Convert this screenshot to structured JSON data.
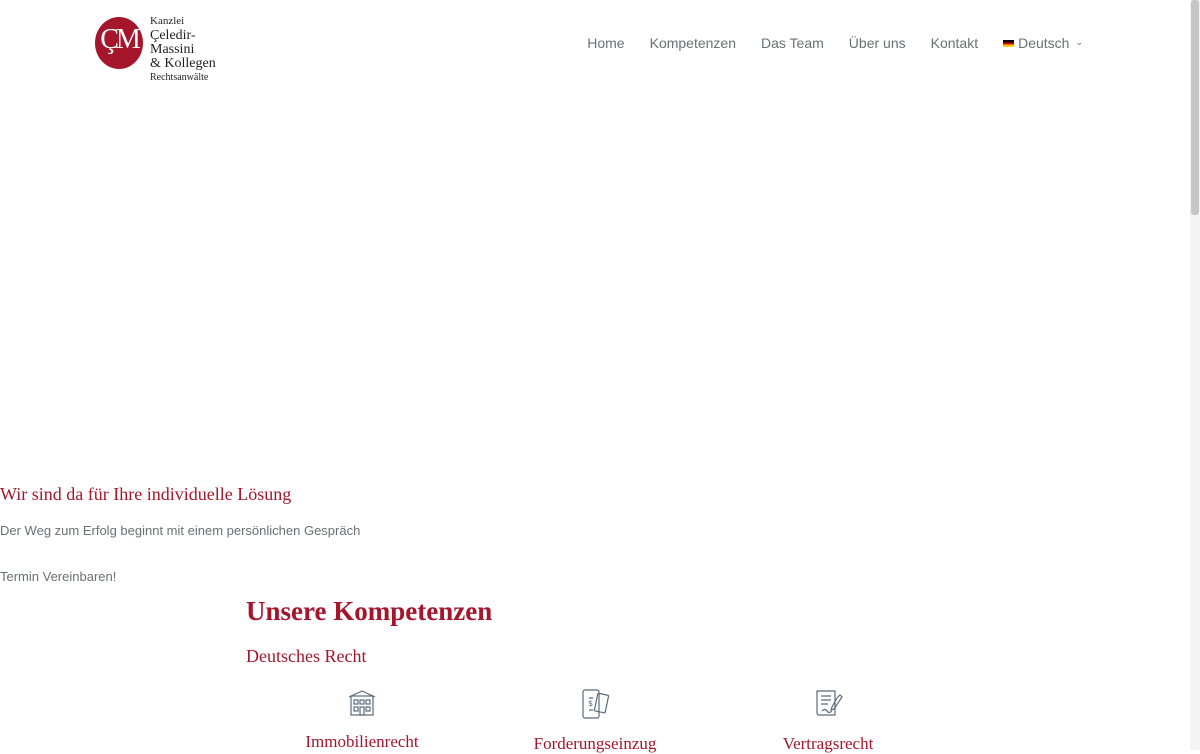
{
  "logo": {
    "mark": "ÇM",
    "line1": "Kanzlei",
    "line2": "Çeledir-Massini",
    "line3": "& Kollegen",
    "line4": "Rechtsanwälte"
  },
  "nav": {
    "items": [
      {
        "label": "Home"
      },
      {
        "label": "Kompetenzen"
      },
      {
        "label": "Das Team"
      },
      {
        "label": "Über uns"
      },
      {
        "label": "Kontakt"
      }
    ],
    "language": "Deutsch"
  },
  "hero": {
    "title": "Wir sind da für Ihre individuelle Lösung",
    "subtitle": "Der Weg zum Erfolg beginnt mit einem persönlichen Gespräch",
    "cta": "Termin Vereinbaren!"
  },
  "competences": {
    "title": "Unsere Kompetenzen",
    "subtitle": "Deutsches Recht",
    "cards": [
      {
        "title": "Immobilienrecht",
        "icon": "building-icon"
      },
      {
        "title": "Forderungseinzug",
        "icon": "money-phone-icon"
      },
      {
        "title": "Vertragsrecht",
        "icon": "contract-icon"
      }
    ]
  },
  "colors": {
    "brand": "#a5162c",
    "text": "#6b6f76",
    "icon": "#5a6b7d"
  }
}
